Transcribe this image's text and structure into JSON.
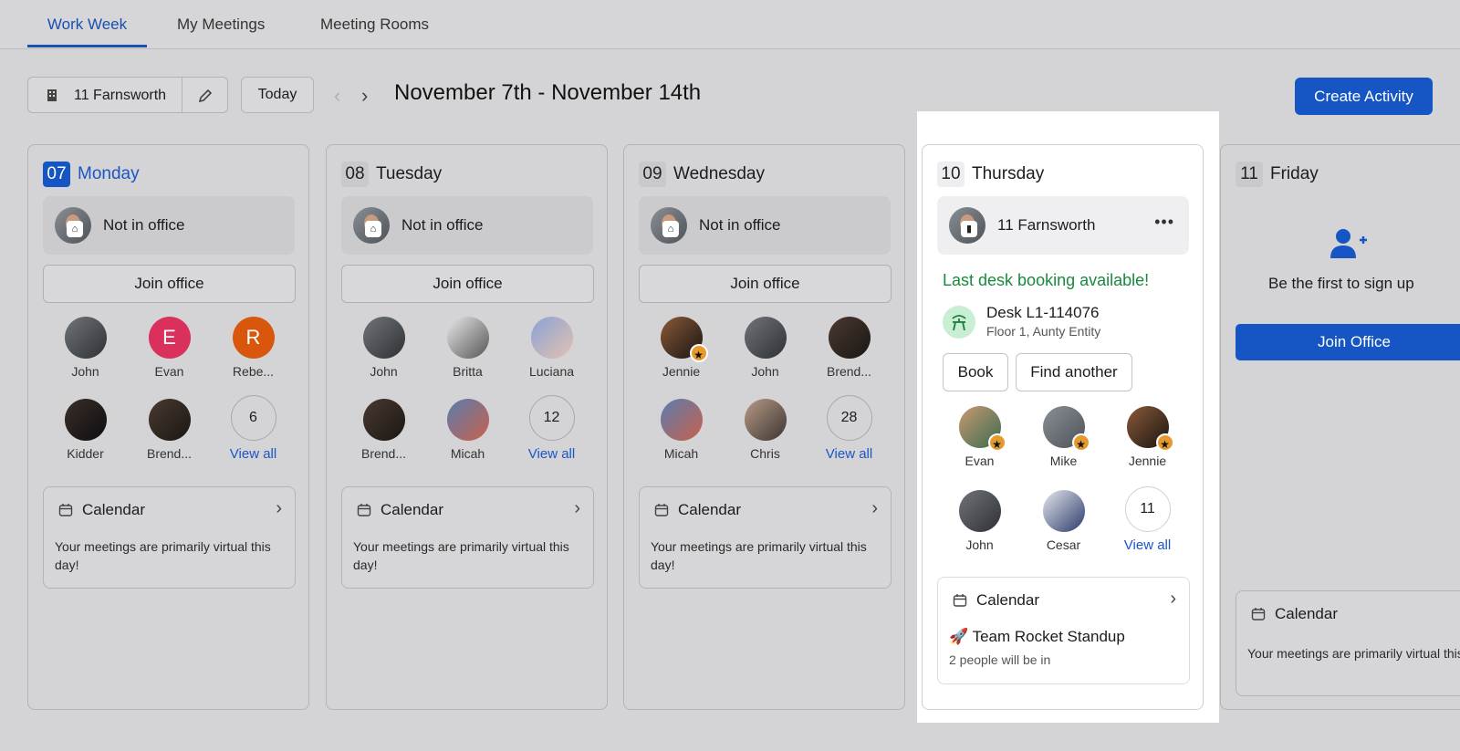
{
  "tabs": [
    {
      "label": "Work Week"
    },
    {
      "label": "My Meetings"
    },
    {
      "label": "Meeting Rooms"
    }
  ],
  "toolbar": {
    "location": "11 Farnsworth",
    "today_label": "Today",
    "date_range": "November 7th - November 14th",
    "create_label": "Create Activity"
  },
  "days": [
    {
      "num": "07",
      "name": "Monday",
      "status": "Not in office",
      "join": "Join office",
      "people": [
        "John",
        "Evan",
        "Rebe...",
        "Kidder",
        "Brend..."
      ],
      "count": "6",
      "view_all": "View all",
      "calendar": "Calendar",
      "cal_text": "Your meetings are primarily virtual this day!"
    },
    {
      "num": "08",
      "name": "Tuesday",
      "status": "Not in office",
      "join": "Join office",
      "people": [
        "John",
        "Britta",
        "Luciana",
        "Brend...",
        "Micah"
      ],
      "count": "12",
      "view_all": "View all",
      "calendar": "Calendar",
      "cal_text": "Your meetings are primarily virtual this day!"
    },
    {
      "num": "09",
      "name": "Wednesday",
      "status": "Not in office",
      "join": "Join office",
      "people": [
        "Jennie",
        "John",
        "Brend...",
        "Micah",
        "Chris"
      ],
      "count": "28",
      "view_all": "View all",
      "calendar": "Calendar",
      "cal_text": "Your meetings are primarily virtual this day!"
    },
    {
      "num": "10",
      "name": "Thursday",
      "status": "11 Farnsworth",
      "desk_available": "Last desk booking available!",
      "desk_name": "Desk L1-114076",
      "desk_sub": "Floor 1, Aunty Entity",
      "book": "Book",
      "find_another": "Find another",
      "people": [
        "Evan",
        "Mike",
        "Jennie",
        "John",
        "Cesar"
      ],
      "count": "11",
      "view_all": "View all",
      "calendar": "Calendar",
      "event": "🚀 Team Rocket Standup",
      "event_sub": "2 people will be in"
    },
    {
      "num": "11",
      "name": "Friday",
      "signup": "Be the first to sign up",
      "join": "Join Office",
      "calendar": "Calendar",
      "cal_text": "Your meetings are primarily virtual this day!"
    }
  ],
  "colors": {
    "accent": "#1556c4",
    "success": "#178a3c",
    "star": "#e69a2e"
  }
}
